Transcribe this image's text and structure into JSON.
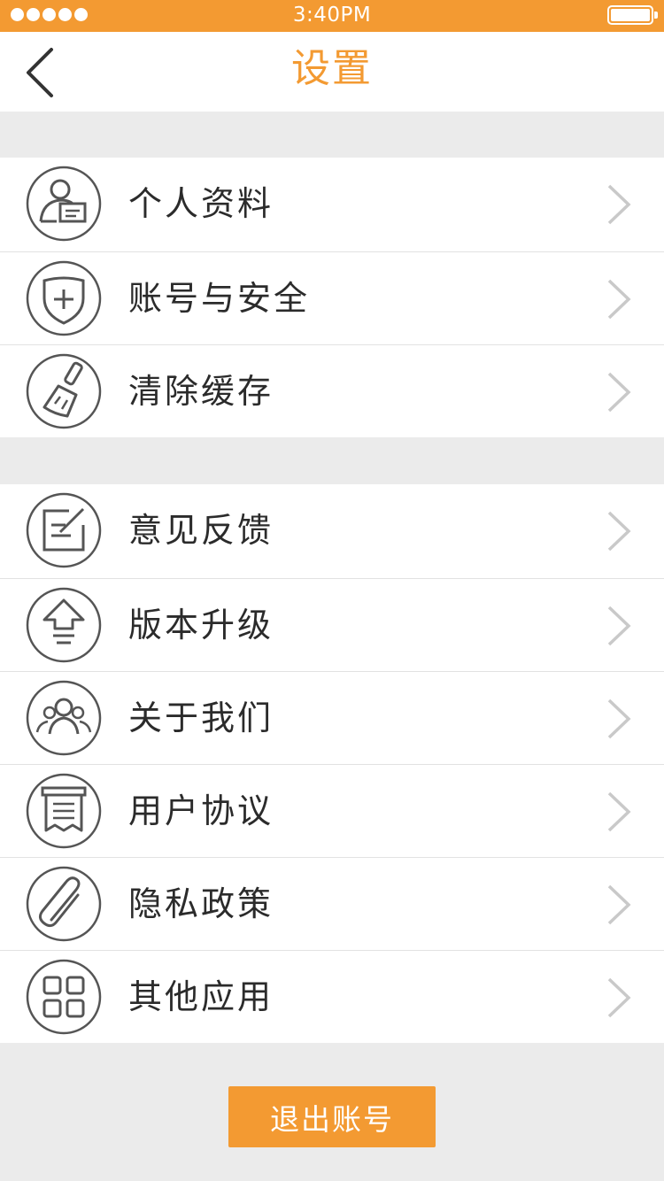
{
  "status_bar": {
    "time": "3:40PM"
  },
  "nav": {
    "title": "设置"
  },
  "group1": [
    {
      "label": "个人资料",
      "icon": "profile-card-icon"
    },
    {
      "label": "账号与安全",
      "icon": "shield-plus-icon"
    },
    {
      "label": "清除缓存",
      "icon": "broom-icon"
    }
  ],
  "group2": [
    {
      "label": "意见反馈",
      "icon": "feedback-edit-icon"
    },
    {
      "label": "版本升级",
      "icon": "upgrade-arrow-icon"
    },
    {
      "label": "关于我们",
      "icon": "people-group-icon"
    },
    {
      "label": "用户协议",
      "icon": "receipt-document-icon"
    },
    {
      "label": "隐私政策",
      "icon": "paperclip-icon"
    },
    {
      "label": "其他应用",
      "icon": "grid-apps-icon"
    }
  ],
  "logout_label": "退出账号",
  "colors": {
    "accent": "#f39a32",
    "background": "#ebebeb",
    "text": "#2b2b2b"
  }
}
